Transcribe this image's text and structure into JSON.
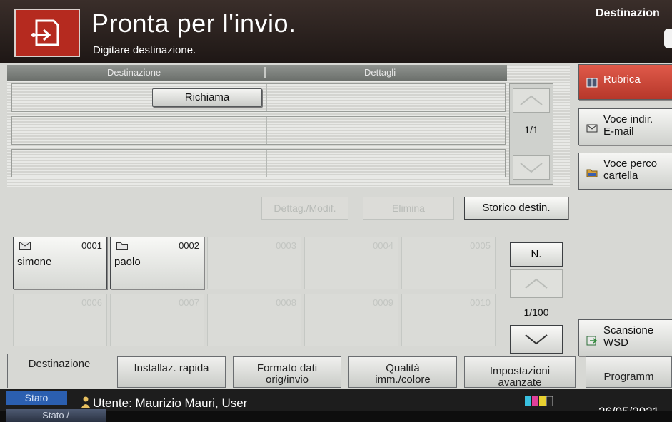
{
  "header": {
    "title": "Pronta per l'invio.",
    "subtitle": "Digitare destinazione.",
    "right_label": "Destinazion"
  },
  "dest_table": {
    "col_destination": "Destinazione",
    "col_details": "Dettagli",
    "recall_button": "Richiama",
    "page_indicator": "1/1"
  },
  "actions": {
    "detail_modify": "Dettag./Modif.",
    "delete": "Elimina",
    "history": "Storico destin."
  },
  "side_buttons": {
    "addressbook": "Rubrica",
    "email_line1": "Voce indir.",
    "email_line2": "E-mail",
    "folder_line1": "Voce perco",
    "folder_line2": "cartella",
    "wsd_line1": "Scansione",
    "wsd_line2": "WSD"
  },
  "keys": [
    {
      "num": "0001",
      "label": "simone"
    },
    {
      "num": "0002",
      "label": "paolo"
    },
    {
      "num": "0003",
      "label": ""
    },
    {
      "num": "0004",
      "label": ""
    },
    {
      "num": "0005",
      "label": ""
    },
    {
      "num": "0006",
      "label": ""
    },
    {
      "num": "0007",
      "label": ""
    },
    {
      "num": "0008",
      "label": ""
    },
    {
      "num": "0009",
      "label": ""
    },
    {
      "num": "0010",
      "label": ""
    }
  ],
  "key_nav": {
    "n_button": "N.",
    "page_indicator": "1/100"
  },
  "tabs": {
    "destination": "Destinazione",
    "quick_setup": "Installaz. rapida",
    "format_line1": "Formato dati",
    "format_line2": "orig/invio",
    "quality_line1": "Qualità",
    "quality_line2": "imm./colore",
    "advanced_line1": "Impostazioni",
    "advanced_line2": "avanzate",
    "programs": "Programm"
  },
  "status": {
    "label": "Stato",
    "user": "Utente: Maurizio Mauri, User",
    "date": "26/05/2021",
    "bottom_button": "Stato /"
  },
  "colors": {
    "accent_red": "#b52a1f",
    "status_blue": "#2b5fb0",
    "header_dark": "#2a211e"
  }
}
